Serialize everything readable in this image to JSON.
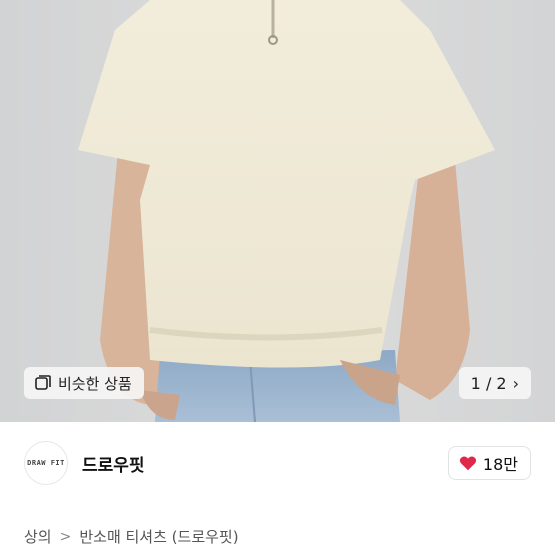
{
  "gallery": {
    "similar_label": "비슷한 상품",
    "similar_icon": "similar-items-icon",
    "pager_text": "1 / 2",
    "next_icon": "chevron-right-icon"
  },
  "seller": {
    "avatar_text": "DRAW FIT",
    "name": "드로우핏",
    "like_count": "18만",
    "like_icon": "heart-icon",
    "like_color": "#e0284b"
  },
  "breadcrumb": {
    "items": [
      "상의",
      "반소매 티셔츠 (드로우핏)"
    ],
    "separator": ">"
  }
}
